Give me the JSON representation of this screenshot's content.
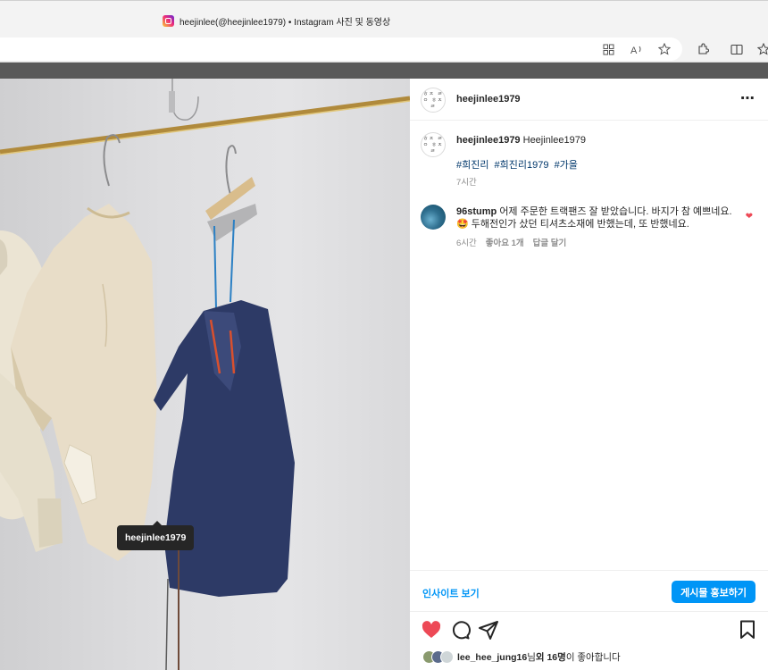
{
  "browser": {
    "tab_title": "heejinlee(@heejinlee1979) • Instagram 사진 및 동영상",
    "icons": [
      "grid-icon",
      "read-aloud-icon",
      "favorite-star-icon",
      "extensions-icon",
      "split-screen-icon",
      "favorites-icon"
    ]
  },
  "post": {
    "username": "heejinlee1979",
    "avatar_text": "ㅎㅈ ㄹㅇ ㅎㅈㄹ",
    "photo_tag": "heejinlee1979",
    "caption": {
      "username": "heejinlee1979",
      "text": "Heejinlee1979",
      "hashtags": [
        "#희진리",
        "#희진리1979",
        "#가을"
      ],
      "time": "7시간"
    },
    "comments": [
      {
        "username": "96stump",
        "text": "어제 주문한 트랙팬즈 잘 받았습니다. 바지가 참 예쁘네요. 🤩 두해전인가 샀던 티셔츠소재에 반했는데, 또 반했네요.",
        "time": "6시간",
        "likes": "좋아요 1개",
        "reply": "답글 달기"
      }
    ],
    "insight_label": "인사이트 보기",
    "promote_label": "게시물 홍보하기",
    "liked_by": {
      "user": "lee_hee_jung16",
      "mid": "님 ",
      "others": "외 16명",
      "tail": "이 좋아합니다"
    }
  },
  "colors": {
    "accent": "#0095f6",
    "like_red": "#ed4956",
    "hashtag": "#00376b"
  }
}
